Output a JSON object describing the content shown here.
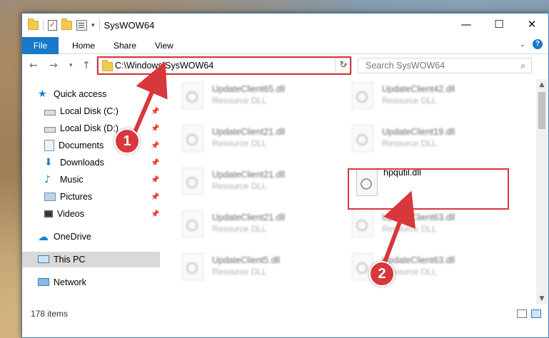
{
  "window": {
    "title": "SysWOW64",
    "min": "—",
    "max": "☐",
    "close": "✕"
  },
  "ribbon": {
    "tabs": [
      "File",
      "Home",
      "Share",
      "View"
    ],
    "help": "?"
  },
  "address": {
    "path": "C:\\Windows\\SysWOW64",
    "search_placeholder": "Search SysWOW64"
  },
  "sidebar": {
    "items": [
      {
        "label": "Quick access",
        "icon": "star-icon",
        "color": "#1e7fd0"
      },
      {
        "label": "Local Disk (C:)",
        "icon": "drive-icon",
        "pinned": true
      },
      {
        "label": "Local Disk (D:)",
        "icon": "drive-icon",
        "pinned": true
      },
      {
        "label": "Documents",
        "icon": "documents-icon",
        "pinned": true
      },
      {
        "label": "Downloads",
        "icon": "download-icon",
        "pinned": true
      },
      {
        "label": "Music",
        "icon": "music-icon",
        "pinned": true
      },
      {
        "label": "Pictures",
        "icon": "pictures-icon",
        "pinned": true
      },
      {
        "label": "Videos",
        "icon": "videos-icon",
        "pinned": true
      },
      {
        "label": "OneDrive",
        "icon": "cloud-icon"
      },
      {
        "label": "This PC",
        "icon": "computer-icon",
        "selected": true
      },
      {
        "label": "Network",
        "icon": "network-icon"
      }
    ]
  },
  "files": [
    {
      "name": "UpdateClient65.dll",
      "type": "Resource DLL"
    },
    {
      "name": "UpdateClient42.dll",
      "type": "Resource DLL"
    },
    {
      "name": "UpdateClient21.dll",
      "type": "Resource DLL"
    },
    {
      "name": "UpdateClient19.dll",
      "type": "Resource DLL"
    },
    {
      "name": "UpdateClient21.dll",
      "type": "Resource DLL"
    },
    {
      "name": "hpqutil.dll",
      "type": ""
    },
    {
      "name": "UpdateClient21.dll",
      "type": "Resource DLL"
    },
    {
      "name": "UpdateClient63.dll",
      "type": "Resource DLL"
    },
    {
      "name": "UpdateClient5.dll",
      "type": "Resource DLL"
    },
    {
      "name": "UpdateClient63.dll",
      "type": "Resource DLL"
    }
  ],
  "status": {
    "item_count": "178 items"
  },
  "callouts": [
    "1",
    "2"
  ],
  "colors": {
    "accent": "#1979ca",
    "highlight": "#d8373b"
  }
}
